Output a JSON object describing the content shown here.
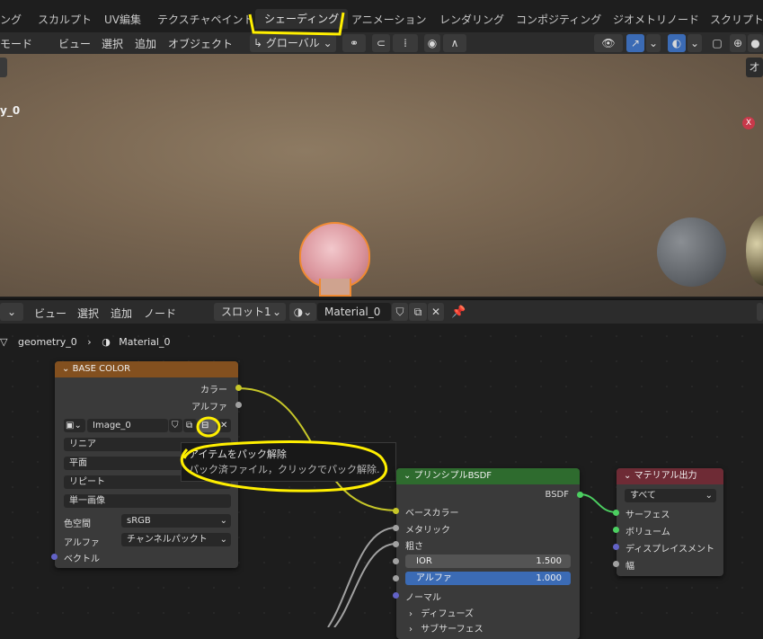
{
  "workspace_tabs": [
    "ング",
    "スカルプト",
    "UV編集",
    "テクスチャペイント",
    "シェーディング",
    "アニメーション",
    "レンダリング",
    "コンポジティング",
    "ジオメトリノード",
    "スクリプト作"
  ],
  "viewport_header": {
    "mode": "モード",
    "menus": [
      "ビュー",
      "選択",
      "追加",
      "オブジェクト"
    ],
    "transform": "グローバル",
    "overlay_label": "オ"
  },
  "viewport": {
    "object_label": "y_0",
    "axis_x": "X"
  },
  "node_header": {
    "menus": [
      "ビュー",
      "選択",
      "追加",
      "ノード"
    ],
    "slot": "スロット1",
    "material": "Material_0"
  },
  "breadcrumb": {
    "object": "geometry_0",
    "material": "Material_0"
  },
  "base_color_node": {
    "title": "BASE COLOR",
    "out_color": "カラー",
    "out_alpha": "アルファ",
    "image_name": "Image_0",
    "interpolation": "リニア",
    "projection": "平面",
    "extension": "リピート",
    "source": "単一画像",
    "colorspace_label": "色空間",
    "colorspace_value": "sRGB",
    "alpha_label": "アルファ",
    "alpha_value": "チャンネルパックト",
    "vector": "ベクトル"
  },
  "tooltip": {
    "line1": "アイテムをパック解除",
    "line2": "パック済ファイル，クリックでパック解除."
  },
  "bsdf_node": {
    "title": "プリンシプルBSDF",
    "out": "BSDF",
    "base_color": "ベースカラー",
    "metallic": "メタリック",
    "roughness": "粗さ",
    "ior_label": "IOR",
    "ior_value": "1.500",
    "alpha_label": "アルファ",
    "alpha_value": "1.000",
    "normal": "ノーマル",
    "diffuse": "ディフューズ",
    "subsurface": "サブサーフェス"
  },
  "output_node": {
    "title": "マテリアル出力",
    "target": "すべて",
    "surface": "サーフェス",
    "volume": "ボリューム",
    "displacement": "ディスプレイスメント",
    "width": "幅"
  },
  "colors": {
    "texture_header": "#83501f",
    "bsdf_header": "#2e6b2e",
    "output_header": "#6e2b35",
    "highlight": "#ffef00",
    "socket_yellow": "#c7c729",
    "socket_grey": "#a1a1a1",
    "socket_purple": "#6363c7",
    "socket_green": "#4ccf61",
    "alpha_slider": "#3b6bb5"
  }
}
